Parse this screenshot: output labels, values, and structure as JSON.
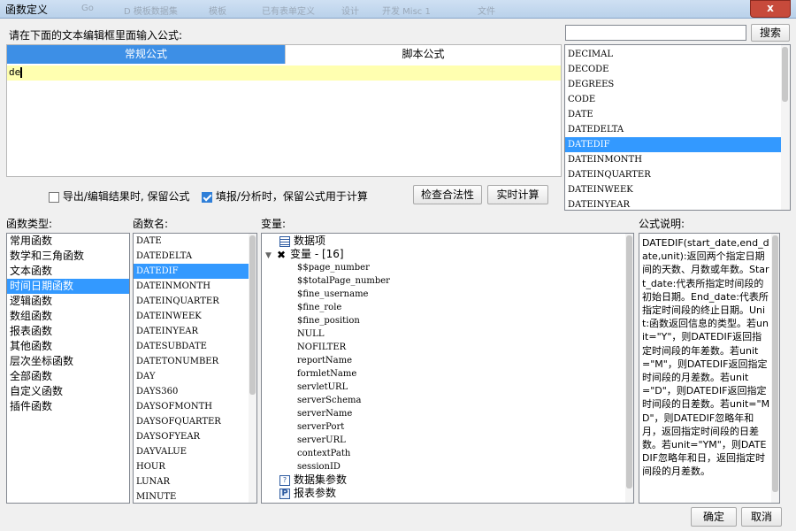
{
  "window": {
    "title": "函数定义",
    "close_label": "x"
  },
  "toolbar_ghost": [
    "Go",
    "D 模板数据集",
    "模板",
    "已有表单定义",
    "设计",
    "开发 Misc 1",
    "文件"
  ],
  "editor": {
    "prompt": "请在下面的文本编辑框里面输入公式:",
    "tabs": [
      "常规公式",
      "脚本公式"
    ],
    "active_tab": 0,
    "formula_value": "de"
  },
  "search": {
    "value": "",
    "button_label": "搜索"
  },
  "suggest_list": {
    "items": [
      "DECIMAL",
      "DECODE",
      "DEGREES",
      "CODE",
      "DATE",
      "DATEDELTA",
      "DATEDIF",
      "DATEINMONTH",
      "DATEINQUARTER",
      "DATEINWEEK",
      "DATEINYEAR"
    ],
    "selected": "DATEDIF"
  },
  "options": {
    "keep_on_export_label": "导出/编辑结果时, 保留公式",
    "keep_on_export_checked": false,
    "keep_on_fill_label": "填报/分析时，保留公式用于计算",
    "keep_on_fill_checked": true,
    "check_button": "检查合法性",
    "realtime_button": "实时计算"
  },
  "function_types": {
    "label": "函数类型:",
    "items": [
      "常用函数",
      "数学和三角函数",
      "文本函数",
      "时间日期函数",
      "逻辑函数",
      "数组函数",
      "报表函数",
      "其他函数",
      "层次坐标函数",
      "全部函数",
      "自定义函数",
      "插件函数"
    ],
    "selected": "时间日期函数"
  },
  "function_names": {
    "label": "函数名:",
    "items": [
      "DATE",
      "DATEDELTA",
      "DATEDIF",
      "DATEINMONTH",
      "DATEINQUARTER",
      "DATEINWEEK",
      "DATEINYEAR",
      "DATESUBDATE",
      "DATETONUMBER",
      "DAY",
      "DAYS360",
      "DAYSOFMONTH",
      "DAYSOFQUARTER",
      "DAYSOFYEAR",
      "DAYVALUE",
      "HOUR",
      "LUNAR",
      "MINUTE"
    ],
    "selected": "DATEDIF"
  },
  "variables": {
    "label": "变量:",
    "data_item": "数据项",
    "var_group": "变量 - [16]",
    "vars": [
      "$$page_number",
      "$$totalPage_number",
      "$fine_username",
      "$fine_role",
      "$fine_position",
      "NULL",
      "NOFILTER",
      "reportName",
      "formletName",
      "servletURL",
      "serverSchema",
      "serverName",
      "serverPort",
      "serverURL",
      "contextPath",
      "sessionID"
    ],
    "dataset_params": "数据集参数",
    "report_params": "报表参数"
  },
  "description": {
    "label": "公式说明:",
    "text": "DATEDIF(start_date,end_date,unit):返回两个指定日期间的天数、月数或年数。Start_date:代表所指定时间段的初始日期。End_date:代表所指定时间段的终止日期。Unit:函数返回信息的类型。若unit=\"Y\"，则DATEDIF返回指定时间段的年差数。若unit=\"M\"，则DATEDIF返回指定时间段的月差数。若unit=\"D\"，则DATEDIF返回指定时间段的日差数。若unit=\"MD\"，则DATEDIF忽略年和月，返回指定时间段的日差数。若unit=\"YM\"，则DATEDIF忽略年和日，返回指定时间段的月差数。"
  },
  "footer": {
    "ok_label": "确定",
    "cancel_label": "取消"
  }
}
